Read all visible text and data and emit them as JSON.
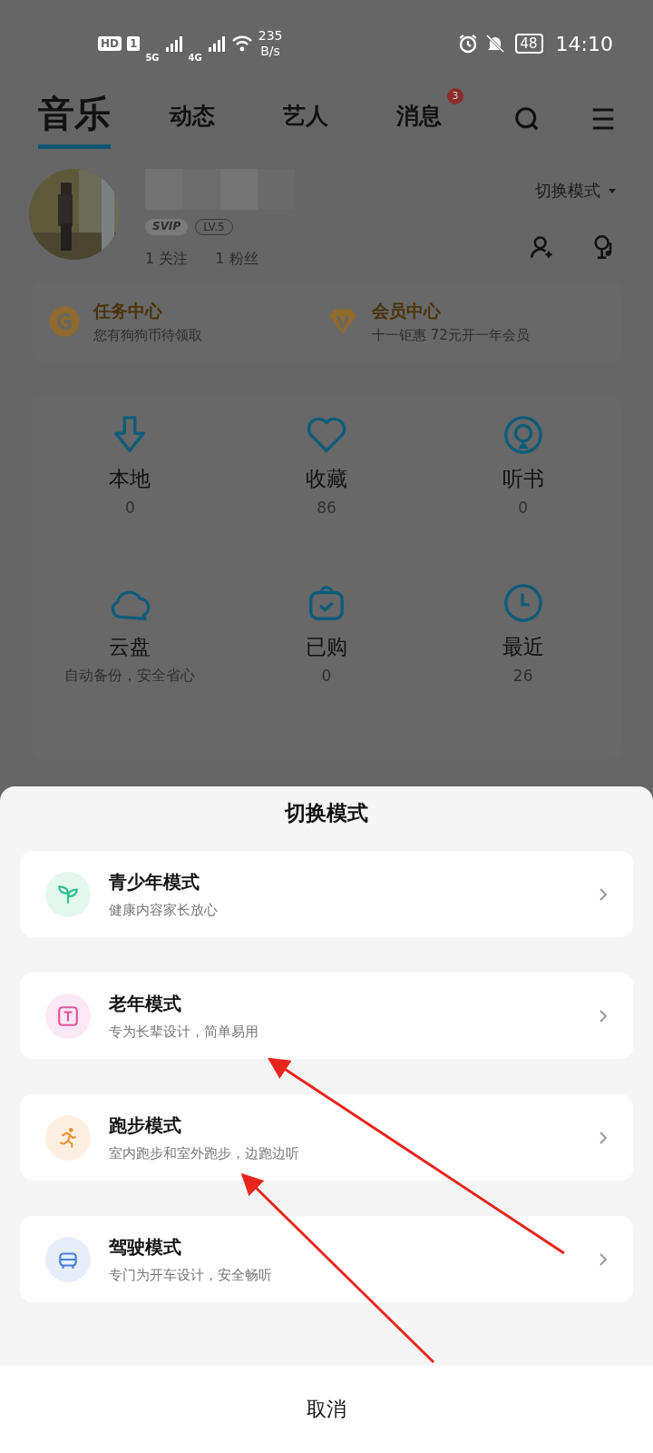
{
  "status_bar": {
    "hd": "HD",
    "sim": "1",
    "net_1": "5G",
    "net_2": "4G",
    "speed": "235",
    "speed_unit": "B/s",
    "battery": "48",
    "time": "14:10"
  },
  "tabs": [
    {
      "label": "音乐",
      "selected": true
    },
    {
      "label": "动态",
      "selected": false
    },
    {
      "label": "艺人",
      "selected": false
    },
    {
      "label": "消息",
      "selected": false,
      "badge": "3"
    }
  ],
  "profile": {
    "badges": [
      "SVIP",
      "LV.5"
    ],
    "following": {
      "count": "1",
      "label": "关注"
    },
    "fans": {
      "count": "1",
      "label": "粉丝"
    },
    "mode_button": "切换模式"
  },
  "promo_cards": [
    {
      "kind": "coin",
      "title": "任务中心",
      "subtitle": "您有狗狗币待领取"
    },
    {
      "kind": "vip",
      "title": "会员中心",
      "subtitle": "十一钜惠 72元开一年会员"
    }
  ],
  "library": [
    {
      "kind": "download",
      "label": "本地",
      "count": "0"
    },
    {
      "kind": "heart",
      "label": "收藏",
      "count": "86"
    },
    {
      "kind": "audiobook",
      "label": "听书",
      "count": "0"
    },
    {
      "kind": "cloud",
      "label": "云盘",
      "note": "自动备份，安全省心"
    },
    {
      "kind": "bag",
      "label": "已购",
      "count": "0"
    },
    {
      "kind": "clock",
      "label": "最近",
      "count": "26"
    }
  ],
  "sheet": {
    "title": "切换模式",
    "options": [
      {
        "kind": "sprout",
        "title": "青少年模式",
        "subtitle": "健康内容家长放心",
        "color": "#2fc08a"
      },
      {
        "kind": "elder",
        "title": "老年模式",
        "subtitle": "专为长辈设计，简单易用",
        "color": "#e0559a"
      },
      {
        "kind": "run",
        "title": "跑步模式",
        "subtitle": "室内跑步和室外跑步，边跑边听",
        "color": "#f0902e"
      },
      {
        "kind": "car",
        "title": "驾驶模式",
        "subtitle": "专门为开车设计，安全畅听",
        "color": "#4a80d8"
      }
    ],
    "cancel": "取消"
  }
}
